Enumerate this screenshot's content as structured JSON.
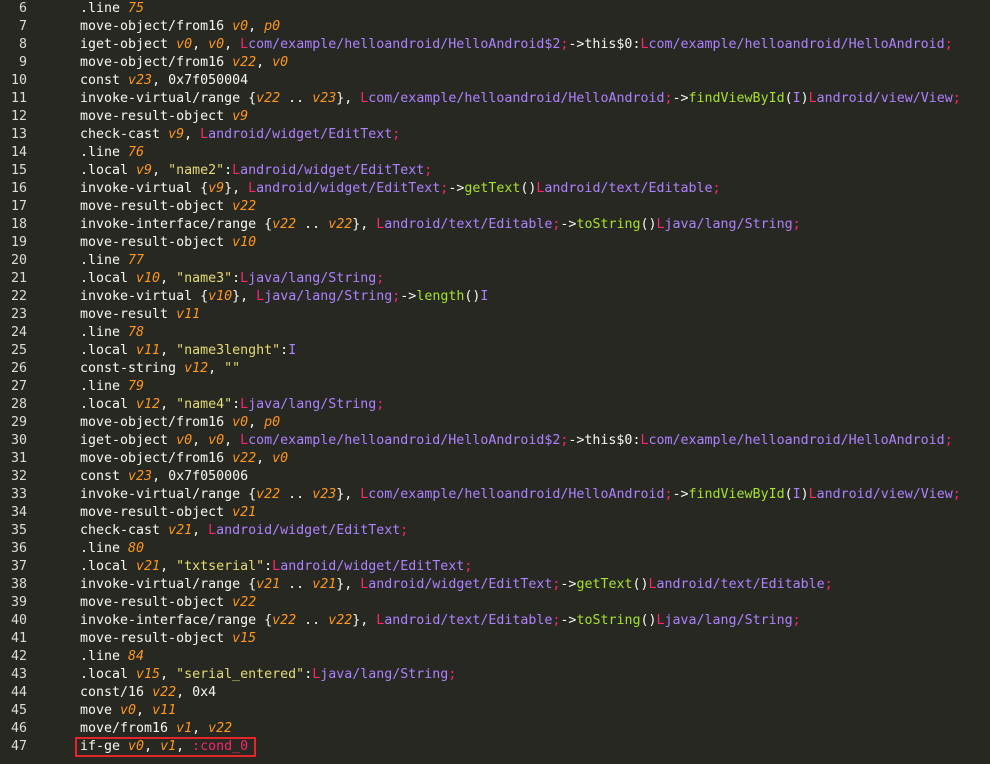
{
  "editor": {
    "lines": [
      {
        "n": "6",
        "t": [
          [
            "kw",
            ".line "
          ],
          [
            "reg",
            "75"
          ]
        ]
      },
      {
        "n": "7",
        "t": [
          [
            "kw",
            "move-object/from16 "
          ],
          [
            "reg",
            "v0"
          ],
          [
            "pun",
            ", "
          ],
          [
            "reg",
            "p0"
          ]
        ]
      },
      {
        "n": "8",
        "t": [
          [
            "kw",
            "iget-object "
          ],
          [
            "reg",
            "v0"
          ],
          [
            "pun",
            ", "
          ],
          [
            "reg",
            "v0"
          ],
          [
            "pun",
            ", "
          ],
          [
            "L",
            "L"
          ],
          [
            "cls",
            "com/example/helloandroid/HelloAndroid$2"
          ],
          [
            "semi",
            ";"
          ],
          [
            "pun",
            "->"
          ],
          [
            "kw",
            "this$0"
          ],
          [
            "pun",
            ":"
          ],
          [
            "L",
            "L"
          ],
          [
            "cls",
            "com/example/helloandroid/HelloAndroid"
          ],
          [
            "semi",
            ";"
          ]
        ]
      },
      {
        "n": "9",
        "t": [
          [
            "kw",
            "move-object/from16 "
          ],
          [
            "reg",
            "v22"
          ],
          [
            "pun",
            ", "
          ],
          [
            "reg",
            "v0"
          ]
        ]
      },
      {
        "n": "10",
        "t": [
          [
            "kw",
            "const "
          ],
          [
            "reg",
            "v23"
          ],
          [
            "pun",
            ", "
          ],
          [
            "kw",
            "0x7f050004"
          ]
        ]
      },
      {
        "n": "11",
        "t": [
          [
            "kw",
            "invoke-virtual/range "
          ],
          [
            "pun",
            "{"
          ],
          [
            "reg",
            "v22"
          ],
          [
            "pun",
            " .. "
          ],
          [
            "reg",
            "v23"
          ],
          [
            "pun",
            "}, "
          ],
          [
            "L",
            "L"
          ],
          [
            "cls",
            "com/example/helloandroid/HelloAndroid"
          ],
          [
            "semi",
            ";"
          ],
          [
            "pun",
            "->"
          ],
          [
            "meth",
            "findViewById"
          ],
          [
            "pun",
            "("
          ],
          [
            "cls",
            "I"
          ],
          [
            "pun",
            ")"
          ],
          [
            "L",
            "L"
          ],
          [
            "cls",
            "android/view/View"
          ],
          [
            "semi",
            ";"
          ]
        ]
      },
      {
        "n": "12",
        "t": [
          [
            "kw",
            "move-result-object "
          ],
          [
            "reg",
            "v9"
          ]
        ]
      },
      {
        "n": "13",
        "t": [
          [
            "kw",
            "check-cast "
          ],
          [
            "reg",
            "v9"
          ],
          [
            "pun",
            ", "
          ],
          [
            "L",
            "L"
          ],
          [
            "cls",
            "android/widget/EditText"
          ],
          [
            "semi",
            ";"
          ]
        ]
      },
      {
        "n": "14",
        "t": [
          [
            "kw",
            ".line "
          ],
          [
            "reg",
            "76"
          ]
        ]
      },
      {
        "n": "15",
        "t": [
          [
            "kw",
            ".local "
          ],
          [
            "reg",
            "v9"
          ],
          [
            "pun",
            ", "
          ],
          [
            "str",
            "\"name2\""
          ],
          [
            "pun",
            ":"
          ],
          [
            "L",
            "L"
          ],
          [
            "cls",
            "android/widget/EditText"
          ],
          [
            "semi",
            ";"
          ]
        ]
      },
      {
        "n": "16",
        "t": [
          [
            "kw",
            "invoke-virtual "
          ],
          [
            "pun",
            "{"
          ],
          [
            "reg",
            "v9"
          ],
          [
            "pun",
            "}, "
          ],
          [
            "L",
            "L"
          ],
          [
            "cls",
            "android/widget/EditText"
          ],
          [
            "semi",
            ";"
          ],
          [
            "pun",
            "->"
          ],
          [
            "meth",
            "getText"
          ],
          [
            "pun",
            "()"
          ],
          [
            "L",
            "L"
          ],
          [
            "cls",
            "android/text/Editable"
          ],
          [
            "semi",
            ";"
          ]
        ]
      },
      {
        "n": "17",
        "t": [
          [
            "kw",
            "move-result-object "
          ],
          [
            "reg",
            "v22"
          ]
        ]
      },
      {
        "n": "18",
        "t": [
          [
            "kw",
            "invoke-interface/range "
          ],
          [
            "pun",
            "{"
          ],
          [
            "reg",
            "v22"
          ],
          [
            "pun",
            " .. "
          ],
          [
            "reg",
            "v22"
          ],
          [
            "pun",
            "}, "
          ],
          [
            "L",
            "L"
          ],
          [
            "cls",
            "android/text/Editable"
          ],
          [
            "semi",
            ";"
          ],
          [
            "pun",
            "->"
          ],
          [
            "meth",
            "toString"
          ],
          [
            "pun",
            "()"
          ],
          [
            "L",
            "L"
          ],
          [
            "cls",
            "java/lang/String"
          ],
          [
            "semi",
            ";"
          ]
        ]
      },
      {
        "n": "19",
        "t": [
          [
            "kw",
            "move-result-object "
          ],
          [
            "reg",
            "v10"
          ]
        ]
      },
      {
        "n": "20",
        "t": [
          [
            "kw",
            ".line "
          ],
          [
            "reg",
            "77"
          ]
        ]
      },
      {
        "n": "21",
        "t": [
          [
            "kw",
            ".local "
          ],
          [
            "reg",
            "v10"
          ],
          [
            "pun",
            ", "
          ],
          [
            "str",
            "\"name3\""
          ],
          [
            "pun",
            ":"
          ],
          [
            "L",
            "L"
          ],
          [
            "cls",
            "java/lang/String"
          ],
          [
            "semi",
            ";"
          ]
        ]
      },
      {
        "n": "22",
        "t": [
          [
            "kw",
            "invoke-virtual "
          ],
          [
            "pun",
            "{"
          ],
          [
            "reg",
            "v10"
          ],
          [
            "pun",
            "}, "
          ],
          [
            "L",
            "L"
          ],
          [
            "cls",
            "java/lang/String"
          ],
          [
            "semi",
            ";"
          ],
          [
            "pun",
            "->"
          ],
          [
            "meth",
            "length"
          ],
          [
            "pun",
            "()"
          ],
          [
            "cls",
            "I"
          ]
        ]
      },
      {
        "n": "23",
        "t": [
          [
            "kw",
            "move-result "
          ],
          [
            "reg",
            "v11"
          ]
        ]
      },
      {
        "n": "24",
        "t": [
          [
            "kw",
            ".line "
          ],
          [
            "reg",
            "78"
          ]
        ]
      },
      {
        "n": "25",
        "t": [
          [
            "kw",
            ".local "
          ],
          [
            "reg",
            "v11"
          ],
          [
            "pun",
            ", "
          ],
          [
            "str",
            "\"name3lenght\""
          ],
          [
            "pun",
            ":"
          ],
          [
            "cls",
            "I"
          ]
        ]
      },
      {
        "n": "26",
        "t": [
          [
            "kw",
            "const-string "
          ],
          [
            "reg",
            "v12"
          ],
          [
            "pun",
            ", "
          ],
          [
            "str",
            "\"\""
          ]
        ]
      },
      {
        "n": "27",
        "t": [
          [
            "kw",
            ".line "
          ],
          [
            "reg",
            "79"
          ]
        ]
      },
      {
        "n": "28",
        "t": [
          [
            "kw",
            ".local "
          ],
          [
            "reg",
            "v12"
          ],
          [
            "pun",
            ", "
          ],
          [
            "str",
            "\"name4\""
          ],
          [
            "pun",
            ":"
          ],
          [
            "L",
            "L"
          ],
          [
            "cls",
            "java/lang/String"
          ],
          [
            "semi",
            ";"
          ]
        ]
      },
      {
        "n": "29",
        "t": [
          [
            "kw",
            "move-object/from16 "
          ],
          [
            "reg",
            "v0"
          ],
          [
            "pun",
            ", "
          ],
          [
            "reg",
            "p0"
          ]
        ]
      },
      {
        "n": "30",
        "t": [
          [
            "kw",
            "iget-object "
          ],
          [
            "reg",
            "v0"
          ],
          [
            "pun",
            ", "
          ],
          [
            "reg",
            "v0"
          ],
          [
            "pun",
            ", "
          ],
          [
            "L",
            "L"
          ],
          [
            "cls",
            "com/example/helloandroid/HelloAndroid$2"
          ],
          [
            "semi",
            ";"
          ],
          [
            "pun",
            "->"
          ],
          [
            "kw",
            "this$0"
          ],
          [
            "pun",
            ":"
          ],
          [
            "L",
            "L"
          ],
          [
            "cls",
            "com/example/helloandroid/HelloAndroid"
          ],
          [
            "semi",
            ";"
          ]
        ]
      },
      {
        "n": "31",
        "t": [
          [
            "kw",
            "move-object/from16 "
          ],
          [
            "reg",
            "v22"
          ],
          [
            "pun",
            ", "
          ],
          [
            "reg",
            "v0"
          ]
        ]
      },
      {
        "n": "32",
        "t": [
          [
            "kw",
            "const "
          ],
          [
            "reg",
            "v23"
          ],
          [
            "pun",
            ", "
          ],
          [
            "kw",
            "0x7f050006"
          ]
        ]
      },
      {
        "n": "33",
        "t": [
          [
            "kw",
            "invoke-virtual/range "
          ],
          [
            "pun",
            "{"
          ],
          [
            "reg",
            "v22"
          ],
          [
            "pun",
            " .. "
          ],
          [
            "reg",
            "v23"
          ],
          [
            "pun",
            "}, "
          ],
          [
            "L",
            "L"
          ],
          [
            "cls",
            "com/example/helloandroid/HelloAndroid"
          ],
          [
            "semi",
            ";"
          ],
          [
            "pun",
            "->"
          ],
          [
            "meth",
            "findViewById"
          ],
          [
            "pun",
            "("
          ],
          [
            "cls",
            "I"
          ],
          [
            "pun",
            ")"
          ],
          [
            "L",
            "L"
          ],
          [
            "cls",
            "android/view/View"
          ],
          [
            "semi",
            ";"
          ]
        ]
      },
      {
        "n": "34",
        "t": [
          [
            "kw",
            "move-result-object "
          ],
          [
            "reg",
            "v21"
          ]
        ]
      },
      {
        "n": "35",
        "t": [
          [
            "kw",
            "check-cast "
          ],
          [
            "reg",
            "v21"
          ],
          [
            "pun",
            ", "
          ],
          [
            "L",
            "L"
          ],
          [
            "cls",
            "android/widget/EditText"
          ],
          [
            "semi",
            ";"
          ]
        ]
      },
      {
        "n": "36",
        "t": [
          [
            "kw",
            ".line "
          ],
          [
            "reg",
            "80"
          ]
        ]
      },
      {
        "n": "37",
        "t": [
          [
            "kw",
            ".local "
          ],
          [
            "reg",
            "v21"
          ],
          [
            "pun",
            ", "
          ],
          [
            "str",
            "\"txtserial\""
          ],
          [
            "pun",
            ":"
          ],
          [
            "L",
            "L"
          ],
          [
            "cls",
            "android/widget/EditText"
          ],
          [
            "semi",
            ";"
          ]
        ]
      },
      {
        "n": "38",
        "t": [
          [
            "kw",
            "invoke-virtual/range "
          ],
          [
            "pun",
            "{"
          ],
          [
            "reg",
            "v21"
          ],
          [
            "pun",
            " .. "
          ],
          [
            "reg",
            "v21"
          ],
          [
            "pun",
            "}, "
          ],
          [
            "L",
            "L"
          ],
          [
            "cls",
            "android/widget/EditText"
          ],
          [
            "semi",
            ";"
          ],
          [
            "pun",
            "->"
          ],
          [
            "meth",
            "getText"
          ],
          [
            "pun",
            "()"
          ],
          [
            "L",
            "L"
          ],
          [
            "cls",
            "android/text/Editable"
          ],
          [
            "semi",
            ";"
          ]
        ]
      },
      {
        "n": "39",
        "t": [
          [
            "kw",
            "move-result-object "
          ],
          [
            "reg",
            "v22"
          ]
        ]
      },
      {
        "n": "40",
        "t": [
          [
            "kw",
            "invoke-interface/range "
          ],
          [
            "pun",
            "{"
          ],
          [
            "reg",
            "v22"
          ],
          [
            "pun",
            " .. "
          ],
          [
            "reg",
            "v22"
          ],
          [
            "pun",
            "}, "
          ],
          [
            "L",
            "L"
          ],
          [
            "cls",
            "android/text/Editable"
          ],
          [
            "semi",
            ";"
          ],
          [
            "pun",
            "->"
          ],
          [
            "meth",
            "toString"
          ],
          [
            "pun",
            "()"
          ],
          [
            "L",
            "L"
          ],
          [
            "cls",
            "java/lang/String"
          ],
          [
            "semi",
            ";"
          ]
        ]
      },
      {
        "n": "41",
        "t": [
          [
            "kw",
            "move-result-object "
          ],
          [
            "reg",
            "v15"
          ]
        ]
      },
      {
        "n": "42",
        "t": [
          [
            "kw",
            ".line "
          ],
          [
            "reg",
            "84"
          ]
        ]
      },
      {
        "n": "43",
        "t": [
          [
            "kw",
            ".local "
          ],
          [
            "reg",
            "v15"
          ],
          [
            "pun",
            ", "
          ],
          [
            "str",
            "\"serial_entered\""
          ],
          [
            "pun",
            ":"
          ],
          [
            "L",
            "L"
          ],
          [
            "cls",
            "java/lang/String"
          ],
          [
            "semi",
            ";"
          ]
        ]
      },
      {
        "n": "44",
        "t": [
          [
            "kw",
            "const/16 "
          ],
          [
            "reg",
            "v22"
          ],
          [
            "pun",
            ", "
          ],
          [
            "kw",
            "0x4"
          ]
        ]
      },
      {
        "n": "45",
        "t": [
          [
            "kw",
            "move "
          ],
          [
            "reg",
            "v0"
          ],
          [
            "pun",
            ", "
          ],
          [
            "reg",
            "v11"
          ]
        ]
      },
      {
        "n": "46",
        "t": [
          [
            "kw",
            "move/from16 "
          ],
          [
            "reg",
            "v1"
          ],
          [
            "pun",
            ", "
          ],
          [
            "reg",
            "v22"
          ]
        ]
      },
      {
        "n": "47",
        "t": [
          [
            "kw",
            "if-ge "
          ],
          [
            "reg",
            "v0"
          ],
          [
            "pun",
            ", "
          ],
          [
            "reg",
            "v1"
          ],
          [
            "pun",
            ", "
          ],
          [
            "lbl",
            ":cond_0"
          ]
        ]
      }
    ]
  },
  "colors": {
    "background": "#272822",
    "highlight_box": "#e2262b"
  }
}
